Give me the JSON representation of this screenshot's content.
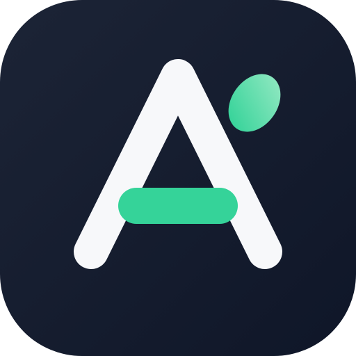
{
  "app_icon": {
    "name": "app-icon",
    "letter_glyph": "A",
    "colors": {
      "background_top": "#1c2436",
      "background_bottom": "#0f1628",
      "letter": "#f7f8fa",
      "crossbar": "#35d399",
      "leaf_light": "#8ee7c0",
      "leaf_dark": "#35d399"
    }
  }
}
